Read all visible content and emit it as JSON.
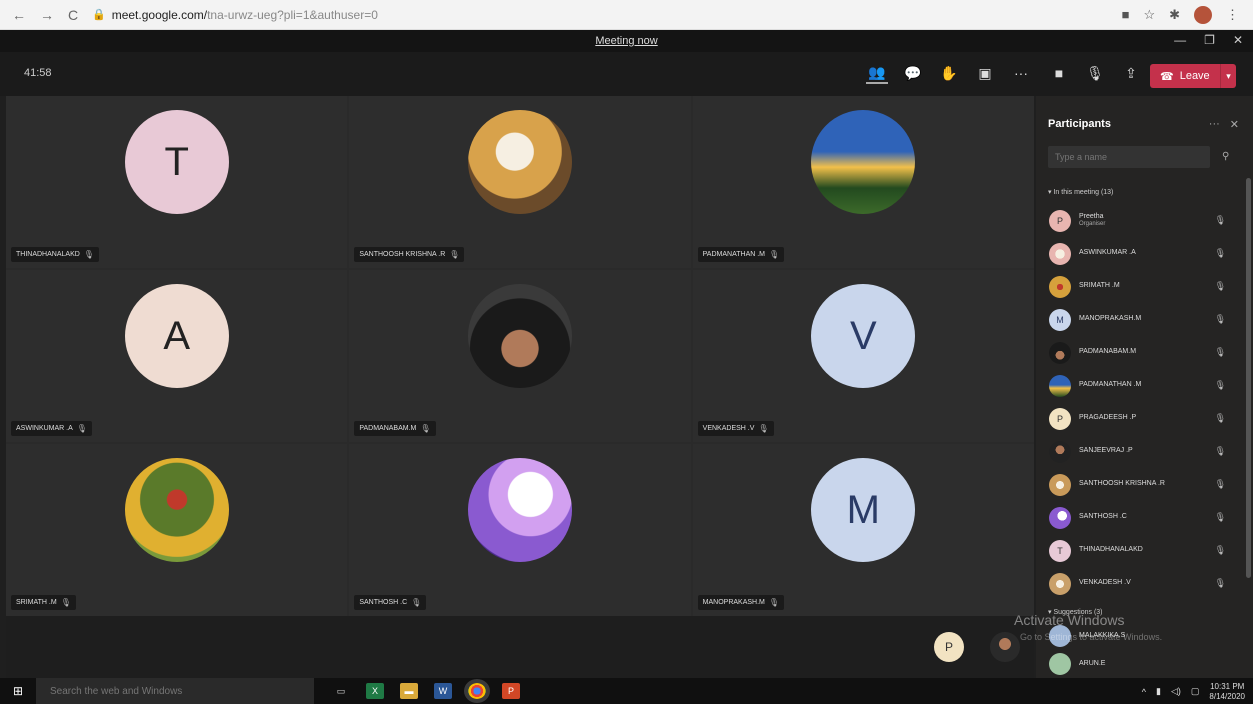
{
  "browser": {
    "url_host": "meet.google.com/",
    "url_path": "tna-urwz-ueg?pli=1&authuser=0"
  },
  "window": {
    "title": "Meeting now"
  },
  "toolbar": {
    "timer": "41:58",
    "leave_label": "Leave"
  },
  "tiles": [
    {
      "name": "THINADHANALAKD",
      "initial": "T",
      "bg": "#e8c9d6"
    },
    {
      "name": "SANTHOOSH KRISHNA .R",
      "initial": "",
      "bg": "#d8a24b"
    },
    {
      "name": "PADMANATHAN .M",
      "initial": "",
      "bg": "#3b6aa3"
    },
    {
      "name": "ASWINKUMAR .A",
      "initial": "A",
      "bg": "#efdcd2"
    },
    {
      "name": "PADMANABAM.M",
      "initial": "",
      "bg": "#3a3a3a"
    },
    {
      "name": "VENKADESH .V",
      "initial": "V",
      "bg": "#c9d6ec"
    },
    {
      "name": "SRIMATH .M",
      "initial": "",
      "bg": "#7a9a3a"
    },
    {
      "name": "SANTHOSH .C",
      "initial": "",
      "bg": "#8a5ad0"
    },
    {
      "name": "MANOPRAKASH.M",
      "initial": "M",
      "bg": "#c9d6ec"
    }
  ],
  "bottom_avatars": [
    {
      "initial": "P",
      "bg": "#f2e3c2"
    },
    {
      "initial": "",
      "bg": "#2a2a2a"
    }
  ],
  "panel": {
    "title": "Participants",
    "search_placeholder": "Type a name",
    "in_meeting_label": "In this meeting (13)",
    "suggestions_label": "Suggestions (3)",
    "participants": [
      {
        "name": "Preetha",
        "sub": "Organiser",
        "initial": "P",
        "bg": "#e8b5b0"
      },
      {
        "name": "ASWINKUMAR .A",
        "sub": "",
        "initial": "",
        "bg": "#e8b5b0"
      },
      {
        "name": "SRIMATH .M",
        "sub": "",
        "initial": "",
        "bg": "#d6a13c"
      },
      {
        "name": "MANOPRAKASH.M",
        "sub": "",
        "initial": "M",
        "bg": "#c9d6ec"
      },
      {
        "name": "PADMANABAM.M",
        "sub": "",
        "initial": "",
        "bg": "#2a2a2a"
      },
      {
        "name": "PADMANATHAN .M",
        "sub": "",
        "initial": "",
        "bg": "#4a7ab5"
      },
      {
        "name": "PRAGADEESH .P",
        "sub": "",
        "initial": "P",
        "bg": "#f2e3c2"
      },
      {
        "name": "SANJEEVRAJ .P",
        "sub": "",
        "initial": "",
        "bg": "#222222"
      },
      {
        "name": "SANTHOOSH KRISHNA .R",
        "sub": "",
        "initial": "",
        "bg": "#c99a5a"
      },
      {
        "name": "SANTHOSH .C",
        "sub": "",
        "initial": "",
        "bg": "#8a5ad0"
      },
      {
        "name": "THINADHANALAKD",
        "sub": "",
        "initial": "T",
        "bg": "#e8c9d6"
      },
      {
        "name": "VENKADESH .V",
        "sub": "",
        "initial": "",
        "bg": "#c9a06a"
      }
    ],
    "suggestions": [
      {
        "name": "MALAKKIKA.S",
        "initial": "",
        "bg": "#9fb6d6"
      },
      {
        "name": "ARUN.E",
        "initial": "",
        "bg": "#9fc6a3"
      }
    ]
  },
  "watermark": {
    "line1": "Activate Windows",
    "line2": "Go to Settings to activate Windows."
  },
  "taskbar": {
    "search_placeholder": "Search the web and Windows",
    "time": "10:31 PM",
    "date": "8/14/2020"
  },
  "colors": {
    "leave_red": "#c4314b",
    "panel_bg": "#252423",
    "tile_bg": "#2d2d2d"
  }
}
